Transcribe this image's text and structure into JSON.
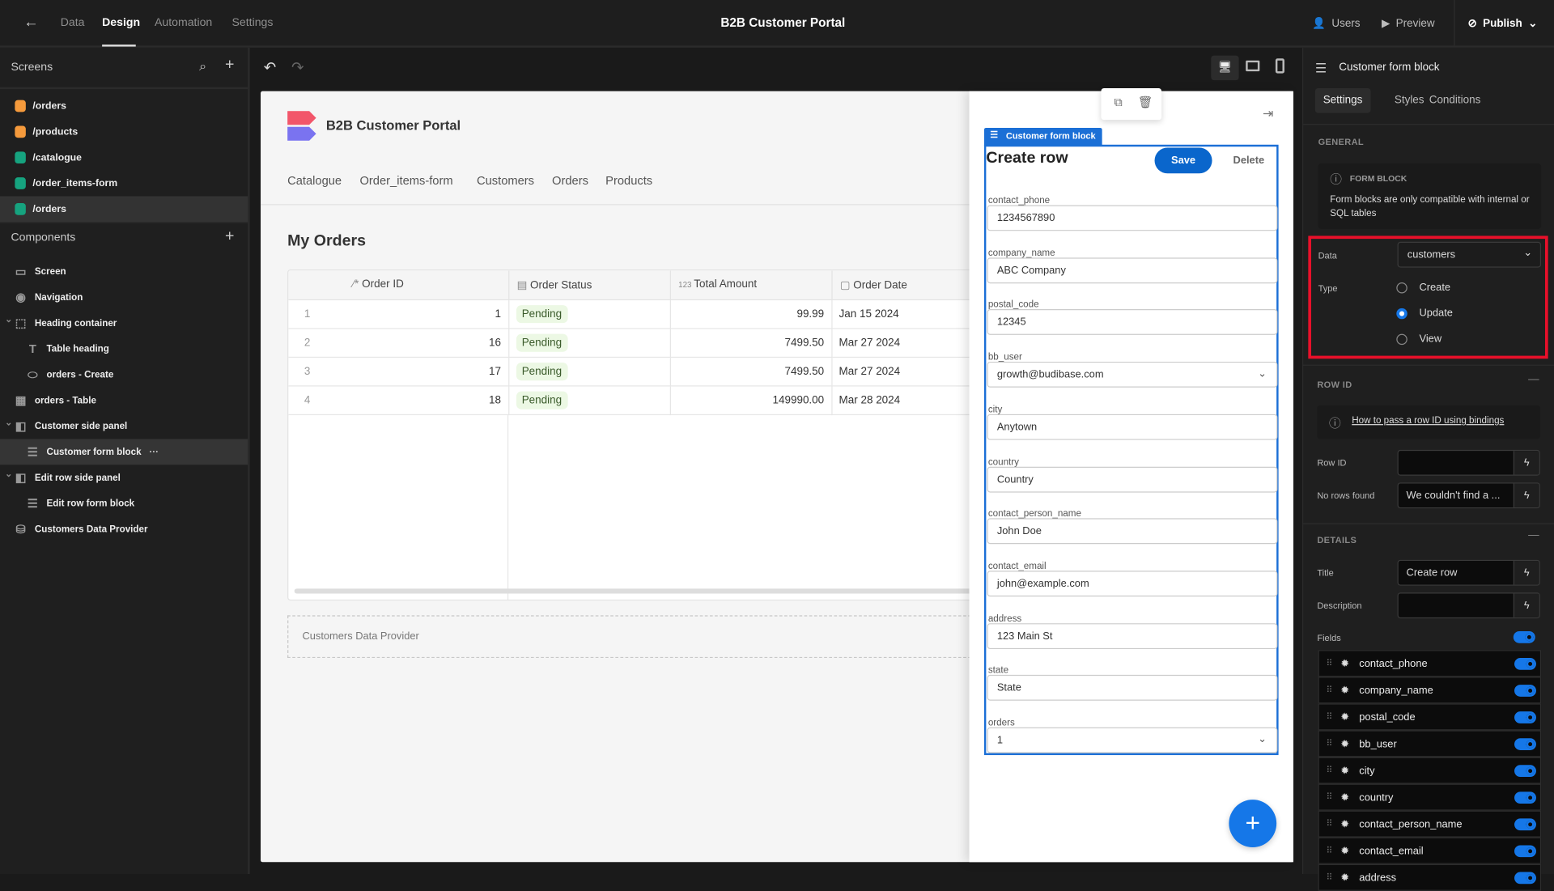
{
  "topbar": {
    "tabs": [
      "Data",
      "Design",
      "Automation",
      "Settings"
    ],
    "active_tab": "Design",
    "title": "B2B Customer Portal",
    "users": "Users",
    "preview": "Preview",
    "publish": "Publish"
  },
  "screens": {
    "title": "Screens",
    "items": [
      {
        "label": "/orders",
        "color": "#f59a3c"
      },
      {
        "label": "/products",
        "color": "#f59a3c"
      },
      {
        "label": "/catalogue",
        "color": "#16a37f"
      },
      {
        "label": "/order_items-form",
        "color": "#16a37f"
      },
      {
        "label": "/orders",
        "color": "#16a37f",
        "selected": true
      }
    ]
  },
  "components": {
    "title": "Components",
    "items": [
      {
        "label": "Screen",
        "depth": 0,
        "icon": "screen-icon"
      },
      {
        "label": "Navigation",
        "depth": 0,
        "icon": "eye-icon"
      },
      {
        "label": "Heading container",
        "depth": 0,
        "icon": "container-icon",
        "expand": true
      },
      {
        "label": "Table heading",
        "depth": 1,
        "icon": "text-icon"
      },
      {
        "label": "orders - Create",
        "depth": 1,
        "icon": "button-icon"
      },
      {
        "label": "orders - Table",
        "depth": 0,
        "icon": "table-icon"
      },
      {
        "label": "Customer side panel",
        "depth": 0,
        "icon": "side-panel-icon",
        "expand": true
      },
      {
        "label": "Customer form block",
        "depth": 1,
        "icon": "form-icon",
        "selected": true
      },
      {
        "label": "Edit row side panel",
        "depth": 0,
        "icon": "side-panel-icon",
        "expand": true
      },
      {
        "label": "Edit row form block",
        "depth": 1,
        "icon": "form-icon"
      },
      {
        "label": "Customers Data Provider",
        "depth": 0,
        "icon": "database-icon"
      }
    ]
  },
  "app": {
    "title": "B2B Customer Portal",
    "nav": [
      "Catalogue",
      "Order_items-form",
      "Customers",
      "Orders",
      "Products"
    ],
    "heading": "My Orders",
    "table": {
      "columns": [
        "Order ID",
        "Order Status",
        "Total Amount",
        "Order Date"
      ],
      "rows": [
        {
          "n": "1",
          "id": "1",
          "status": "Pending",
          "amount": "99.99",
          "date": "Jan 15 2024"
        },
        {
          "n": "2",
          "id": "16",
          "status": "Pending",
          "amount": "7499.50",
          "date": "Mar 27 2024"
        },
        {
          "n": "3",
          "id": "17",
          "status": "Pending",
          "amount": "7499.50",
          "date": "Mar 27 2024"
        },
        {
          "n": "4",
          "id": "18",
          "status": "Pending",
          "amount": "149990.00",
          "date": "Mar 28 2024"
        }
      ]
    },
    "data_provider": "Customers Data Provider"
  },
  "form": {
    "tag": "Customer form block",
    "title": "Create row",
    "save": "Save",
    "delete": "Delete",
    "fields": [
      {
        "label": "contact_phone",
        "value": "1234567890"
      },
      {
        "label": "company_name",
        "value": "ABC Company"
      },
      {
        "label": "postal_code",
        "value": "12345"
      },
      {
        "label": "bb_user",
        "value": "growth@budibase.com",
        "select": true
      },
      {
        "label": "city",
        "value": "Anytown"
      },
      {
        "label": "country",
        "value": "Country"
      },
      {
        "label": "contact_person_name",
        "value": "John Doe"
      },
      {
        "label": "contact_email",
        "value": "john@example.com"
      },
      {
        "label": "address",
        "value": "123 Main St"
      },
      {
        "label": "state",
        "value": "State"
      },
      {
        "label": "orders",
        "value": "1",
        "select": true
      }
    ]
  },
  "props": {
    "title": "Customer form block",
    "tabs": [
      "Settings",
      "Styles",
      "Conditions"
    ],
    "active_tab": "Settings",
    "general": "GENERAL",
    "info_title": "FORM BLOCK",
    "info_text": "Form blocks are only compatible with internal or SQL tables",
    "data_label": "Data",
    "data_value": "customers",
    "type_label": "Type",
    "type_options": [
      "Create",
      "Update",
      "View"
    ],
    "type_selected": "Update",
    "rowid_header": "ROW ID",
    "rowid_link": "How to pass a row ID using bindings",
    "rowid_label": "Row ID",
    "rowid_value": "",
    "norows_label": "No rows found",
    "norows_value": "We couldn't find a ...",
    "details_header": "DETAILS",
    "title_label": "Title",
    "title_value": "Create row",
    "desc_label": "Description",
    "desc_value": "",
    "fields_label": "Fields",
    "fields_enabled": true,
    "fields": [
      "contact_phone",
      "company_name",
      "postal_code",
      "bb_user",
      "city",
      "country",
      "contact_person_name",
      "contact_email",
      "address"
    ],
    "highlight_color": "#e8102a",
    "accent": "#1577e8"
  }
}
